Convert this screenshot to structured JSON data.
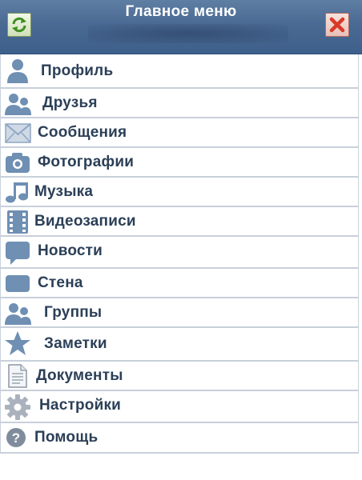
{
  "header": {
    "title": "Главное меню",
    "refresh_icon": "refresh-icon",
    "close_icon": "close-icon"
  },
  "menu": {
    "items": [
      {
        "label": "Профиль",
        "icon": "profile-icon"
      },
      {
        "label": "Друзья",
        "icon": "friends-icon"
      },
      {
        "label": "Сообщения",
        "icon": "messages-icon"
      },
      {
        "label": "Фотографии",
        "icon": "photos-icon"
      },
      {
        "label": "Музыка",
        "icon": "music-icon"
      },
      {
        "label": "Видеозаписи",
        "icon": "videos-icon"
      },
      {
        "label": "Новости",
        "icon": "news-icon"
      },
      {
        "label": "Стена",
        "icon": "wall-icon"
      },
      {
        "label": "Группы",
        "icon": "groups-icon"
      },
      {
        "label": "Заметки",
        "icon": "notes-icon"
      },
      {
        "label": "Документы",
        "icon": "documents-icon"
      },
      {
        "label": "Настройки",
        "icon": "settings-icon"
      },
      {
        "label": "Помощь",
        "icon": "help-icon"
      }
    ]
  },
  "colors": {
    "header_bg": "#4a6a93",
    "icon_blue": "#6f8fb3",
    "label_text": "#2b3f57",
    "divider": "#c8d0db"
  }
}
